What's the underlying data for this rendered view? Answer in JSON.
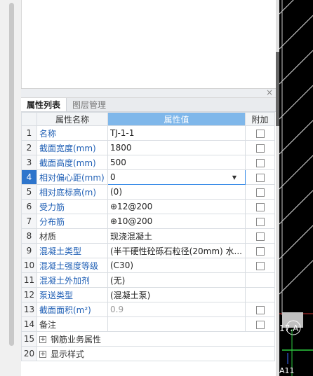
{
  "tabs": [
    {
      "label": "属性列表"
    },
    {
      "label": "图层管理"
    }
  ],
  "columns": {
    "name": "属性名称",
    "value": "属性值",
    "add": "附加"
  },
  "rows": [
    {
      "num": "1",
      "name": "名称",
      "value": "TJ-1-1"
    },
    {
      "num": "2",
      "name": "截面宽度(mm)",
      "value": "1800"
    },
    {
      "num": "3",
      "name": "截面高度(mm)",
      "value": "500"
    },
    {
      "num": "4",
      "name": "相对偏心距(mm)",
      "value": "0"
    },
    {
      "num": "5",
      "name": "相对底标高(m)",
      "value": "(0)"
    },
    {
      "num": "6",
      "name": "受力筋",
      "value": "⊕12@200"
    },
    {
      "num": "7",
      "name": "分布筋",
      "value": "⊕10@200"
    },
    {
      "num": "8",
      "name": "材质",
      "value": "现浇混凝土"
    },
    {
      "num": "9",
      "name": "混凝土类型",
      "value": "(半干硬性砼砾石粒径(20mm) 水..."
    },
    {
      "num": "10",
      "name": "混凝土强度等级",
      "value": "(C30)"
    },
    {
      "num": "11",
      "name": "混凝土外加剂",
      "value": "(无)"
    },
    {
      "num": "12",
      "name": "泵送类型",
      "value": "(混凝土泵)"
    },
    {
      "num": "13",
      "name": "截面面积(m²)",
      "value": "0.9"
    },
    {
      "num": "14",
      "name": "备注",
      "value": ""
    },
    {
      "num": "15",
      "name": "钢筋业务属性",
      "value": ""
    },
    {
      "num": "20",
      "name": "显示样式",
      "value": ""
    }
  ],
  "canvas": {
    "label_a": "17.A",
    "label_b": "A11"
  },
  "icons": {
    "close": "close-icon",
    "dropdown": "chevron-down-icon",
    "expand": "plus-expand-icon"
  },
  "colors": {
    "header_selected": "#7fb7ea",
    "row_selected": "#2e75cc",
    "link_blue": "#1f5fb5"
  }
}
